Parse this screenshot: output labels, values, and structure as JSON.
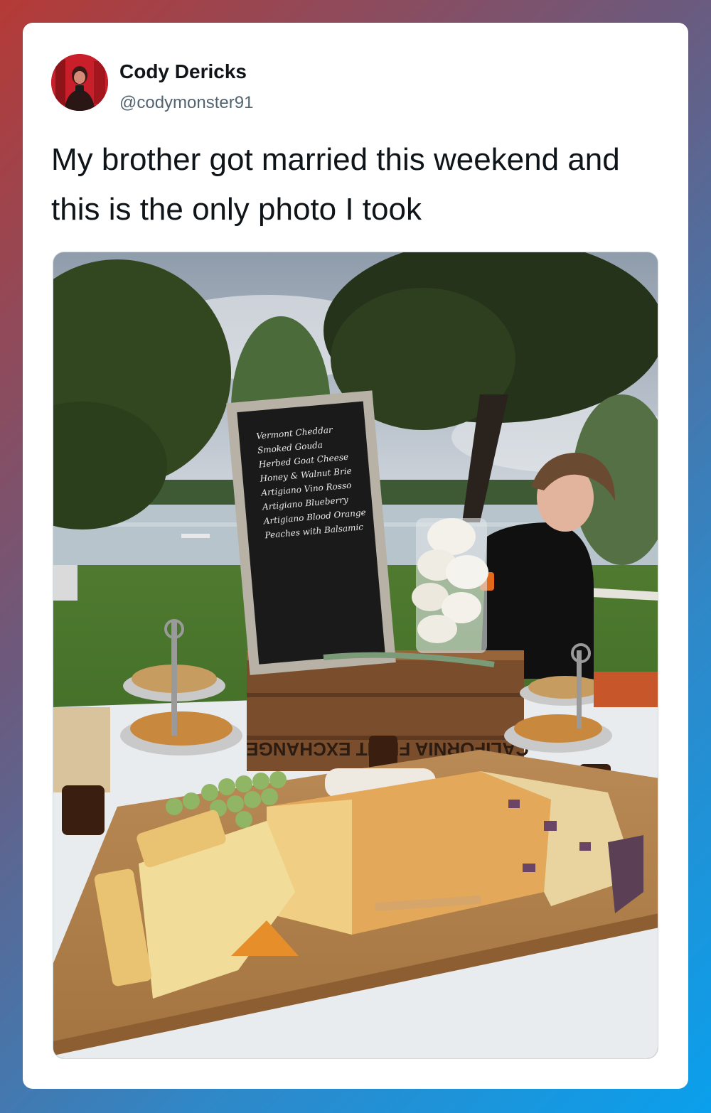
{
  "tweet": {
    "author": {
      "display_name": "Cody Dericks",
      "handle": "@codymonster91"
    },
    "text": "My brother got married this weekend and this is the only photo I took"
  },
  "photo": {
    "chalkboard_lines": [
      "Vermont Cheddar",
      "Smoked Gouda",
      "Herbed Goat Cheese",
      "Honey & Walnut Brie",
      "Artigiano Vino Rosso",
      "Artigiano Blueberry",
      "Artigiano Blood Orange",
      "Peaches with Balsamic"
    ],
    "crate_label": "CALIFORNIA FRUIT EXCHANGE"
  },
  "colors": {
    "background_gradient": [
      "#b53a36",
      "#6b5a7e",
      "#2f88c8",
      "#0aa0ec"
    ],
    "card": "#ffffff",
    "name": "#0f1419",
    "handle": "#536471"
  },
  "icons": {
    "avatar": "profile-photo"
  }
}
